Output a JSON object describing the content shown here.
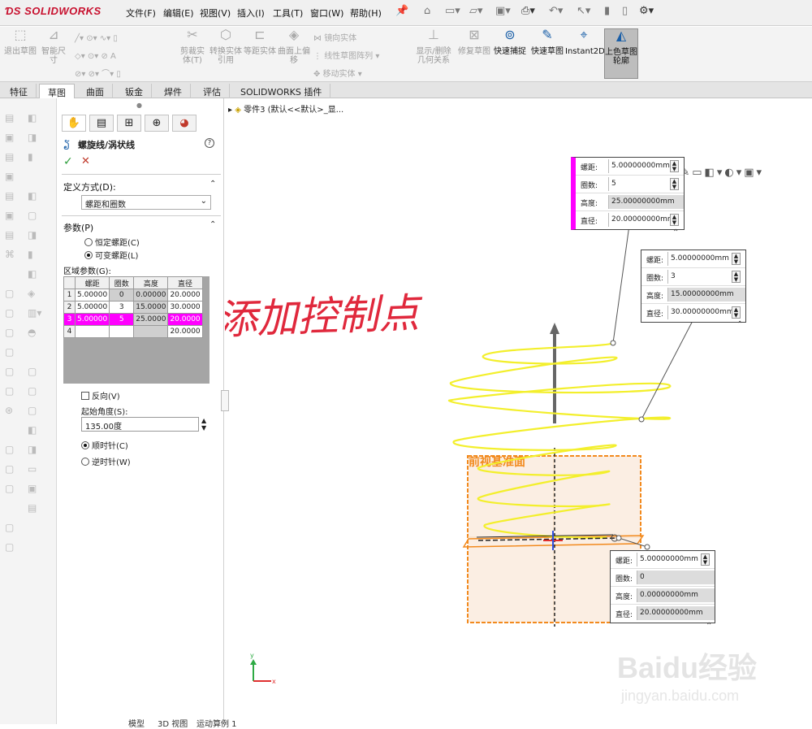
{
  "app": {
    "logo_text": "SOLIDWORKS",
    "brand_color": "#c8102e"
  },
  "menu": [
    "文件(F)",
    "编辑(E)",
    "视图(V)",
    "插入(I)",
    "工具(T)",
    "窗口(W)",
    "帮助(H)"
  ],
  "ribbon": {
    "exit_sketch": "退出草图",
    "smart_dim": "智能尺寸",
    "trim": "剪裁实体(T)",
    "convert": "转换实体引用",
    "offset": "等距实体",
    "surface_offset": "曲面上偏移",
    "mirror": "镜向实体",
    "linear_pattern": "线性草图阵列",
    "move": "移动实体",
    "show_relations": "显示/删除几何关系",
    "repair": "修复草图",
    "quick_snap": "快速捕捉",
    "rapid_sketch": "快速草图",
    "instant2d": "Instant2D",
    "shaded": "上色草图轮廓"
  },
  "tabs": [
    "特征",
    "草图",
    "曲面",
    "钣金",
    "焊件",
    "评估",
    "SOLIDWORKS 插件"
  ],
  "active_tab": "草图",
  "tree": {
    "item": "零件3 (默认<<默认>_显..."
  },
  "panel": {
    "title": "螺旋线/涡状线",
    "help": "?",
    "ok": "✓",
    "cancel": "✕",
    "define_label": "定义方式(D):",
    "define_value": "螺距和圈数",
    "params_label": "参数(P)",
    "opt_constant": "恒定螺距(C)",
    "opt_variable": "可变螺距(L)",
    "region_label": "区域参数(G):",
    "table": {
      "headers": [
        "螺距",
        "圈数",
        "高度",
        "直径"
      ],
      "rows": [
        {
          "n": "1",
          "cells": [
            "5.00000",
            "0",
            "0.00000",
            "20.0000"
          ]
        },
        {
          "n": "2",
          "cells": [
            "5.00000",
            "3",
            "15.0000",
            "30.0000"
          ]
        },
        {
          "n": "3",
          "cells": [
            "5.00000",
            "5",
            "25.0000",
            "20.0000"
          ]
        },
        {
          "n": "4",
          "cells": [
            "",
            "",
            "",
            "20.0000"
          ]
        }
      ]
    },
    "reverse": "反向(V)",
    "start_angle_label": "起始角度(S):",
    "start_angle_value": "135.00度",
    "cw": "顺时针(C)",
    "ccw": "逆时针(W)"
  },
  "annotation": "添加控制点",
  "callouts": [
    {
      "rows": [
        {
          "label": "螺距:",
          "value": "5.00000000mm",
          "spin": true
        },
        {
          "label": "圈数:",
          "value": "5",
          "spin": true
        },
        {
          "label": "高度:",
          "value": "25.00000000mm",
          "spin": false
        },
        {
          "label": "直径:",
          "value": "20.00000000mm",
          "spin": true
        }
      ]
    },
    {
      "rows": [
        {
          "label": "螺距:",
          "value": "5.00000000mm",
          "spin": true
        },
        {
          "label": "圈数:",
          "value": "3",
          "spin": true
        },
        {
          "label": "高度:",
          "value": "15.00000000mm",
          "spin": false
        },
        {
          "label": "直径:",
          "value": "30.00000000mm",
          "spin": true
        }
      ]
    },
    {
      "rows": [
        {
          "label": "螺距:",
          "value": "5.00000000mm",
          "spin": true
        },
        {
          "label": "圈数:",
          "value": "0",
          "spin": false
        },
        {
          "label": "高度:",
          "value": "0.00000000mm",
          "spin": false
        },
        {
          "label": "直径:",
          "value": "20.00000000mm",
          "spin": false
        }
      ]
    }
  ],
  "plane_label": "前视基准面",
  "axes": {
    "y": "y",
    "x": "x"
  },
  "watermark": {
    "brand": "Baidu经验",
    "url": "jingyan.baidu.com"
  },
  "footer": [
    "模型",
    "3D 视图",
    "运动算例 1"
  ],
  "colors": {
    "helix": "#f3ef2c",
    "plane": "#f28a1e",
    "magenta": "#ff00ff",
    "axis": "#777777"
  }
}
